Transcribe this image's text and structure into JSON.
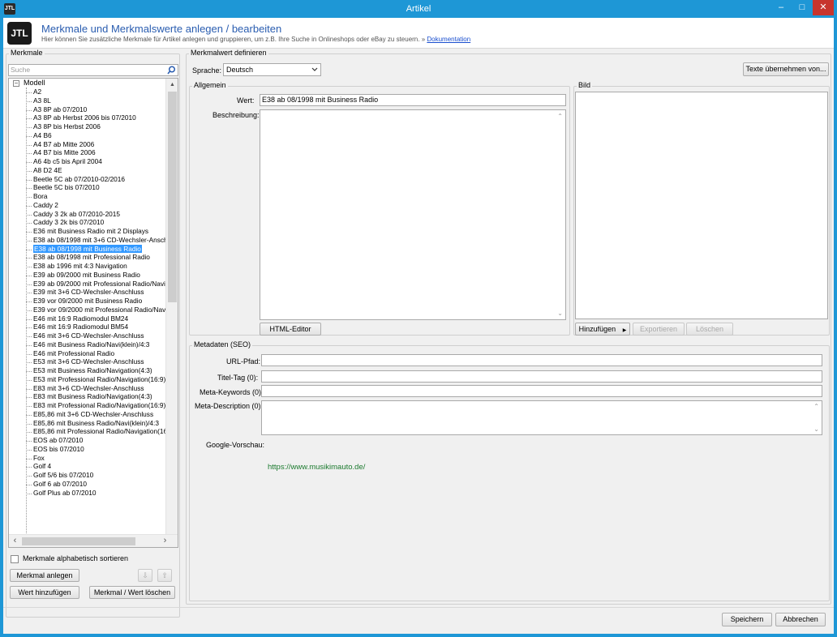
{
  "window": {
    "app_icon": "JTL",
    "title": "Artikel",
    "min_glyph": "–",
    "max_glyph": "□",
    "close_glyph": "✕"
  },
  "header": {
    "logo": "JTL",
    "title": "Merkmale und Merkmalswerte anlegen / bearbeiten",
    "subtitle": "Hier können Sie zusätzliche Merkmale für Artikel anlegen und gruppieren, um z.B. Ihre Suche in Onlineshops oder eBay zu steuern. » ",
    "doc_link": "Dokumentation"
  },
  "left": {
    "group_label": "Merkmale",
    "search_placeholder": "Suche",
    "search_icon": "search-icon",
    "tree_root": "Modell",
    "tree_items": [
      "A2",
      "A3 8L",
      "A3 8P ab 07/2010",
      "A3 8P ab Herbst 2006 bis 07/2010",
      "A3 8P bis Herbst 2006",
      "A4 B6",
      "A4 B7 ab Mitte 2006",
      "A4 B7 bis Mitte 2006",
      "A6 4b c5 bis April 2004",
      "A8 D2 4E",
      "Beetle 5C ab 07/2010-02/2016",
      "Beetle 5C bis 07/2010",
      "Bora",
      "Caddy 2",
      "Caddy 3 2k ab 07/2010-2015",
      "Caddy 3 2k bis 07/2010",
      "E36 mit Business Radio mit 2 Displays",
      "E38 ab 08/1998 mit 3+6 CD-Wechsler-Anschl",
      "E38 ab 08/1998 mit Business Radio",
      "E38 ab 08/1998 mit Professional Radio",
      "E38 ab 1996 mit 4:3 Navigation",
      "E39 ab 09/2000 mit Business Radio",
      "E39 ab 09/2000 mit Professional Radio/Navig",
      "E39 mit 3+6 CD-Wechsler-Anschluss",
      "E39 vor 09/2000 mit Business Radio",
      "E39 vor 09/2000 mit Professional Radio/Navi",
      "E46 mit 16:9 Radiomodul BM24",
      "E46 mit 16:9 Radiomodul BM54",
      "E46 mit 3+6 CD-Wechsler-Anschluss",
      "E46 mit Business Radio/Navi(klein)/4:3",
      "E46 mit Professional Radio",
      "E53 mit 3+6 CD-Wechsler-Anschluss",
      "E53 mit Business Radio/Navigation(4:3)",
      "E53 mit Professional Radio/Navigation(16:9)",
      "E83 mit 3+6 CD-Wechsler-Anschluss",
      "E83 mit Business Radio/Navigation(4:3)",
      "E83 mit Professional Radio/Navigation(16:9)",
      "E85,86 mit 3+6 CD-Wechsler-Anschluss",
      "E85,86 mit Business Radio/Navi(klein)/4:3",
      "E85,86 mit Professional Radio/Navigation(16:",
      "EOS ab 07/2010",
      "EOS bis 07/2010",
      "Fox",
      "Golf 4",
      "Golf 5/6 bis 07/2010",
      "Golf 6 ab 07/2010",
      "Golf Plus ab 07/2010"
    ],
    "selected_index": 18,
    "sort_checkbox_label": "Merkmale alphabetisch sortieren",
    "btn_create": "Merkmal anlegen",
    "btn_down": "⇩",
    "btn_up": "⇧",
    "btn_add_value": "Wert hinzufügen",
    "btn_delete": "Merkmal / Wert löschen",
    "scroll_up": "▲",
    "scroll_left": "‹",
    "scroll_right": "›"
  },
  "right": {
    "group_label": "Merkmalwert definieren",
    "language_label": "Sprache:",
    "language_value": "Deutsch",
    "btn_copy_texts": "Texte übernehmen von...",
    "general": {
      "label": "Allgemein",
      "value_label": "Wert:",
      "value": "E38 ab 08/1998 mit Business Radio",
      "description_label": "Beschreibung:",
      "description": "",
      "html_editor": "HTML-Editor"
    },
    "image": {
      "label": "Bild",
      "btn_add": "Hinzufügen",
      "btn_export": "Exportieren",
      "btn_delete": "Löschen"
    },
    "seo": {
      "label": "Metadaten (SEO)",
      "url_label": "URL-Pfad:",
      "url_value": "",
      "title_label": "Titel-Tag (0):",
      "title_value": "",
      "keywords_label": "Meta-Keywords (0):",
      "keywords_value": "",
      "description_label": "Meta-Description (0):",
      "description_value": "",
      "preview_label": "Google-Vorschau:",
      "preview_url": "https://www.musikimauto.de/"
    }
  },
  "footer": {
    "save": "Speichern",
    "cancel": "Abbrechen"
  },
  "colors": {
    "title_bar": "#1e97d6",
    "close_button": "#c7352d",
    "selection": "#3399ff",
    "preview_url": "#1b7a2e"
  }
}
